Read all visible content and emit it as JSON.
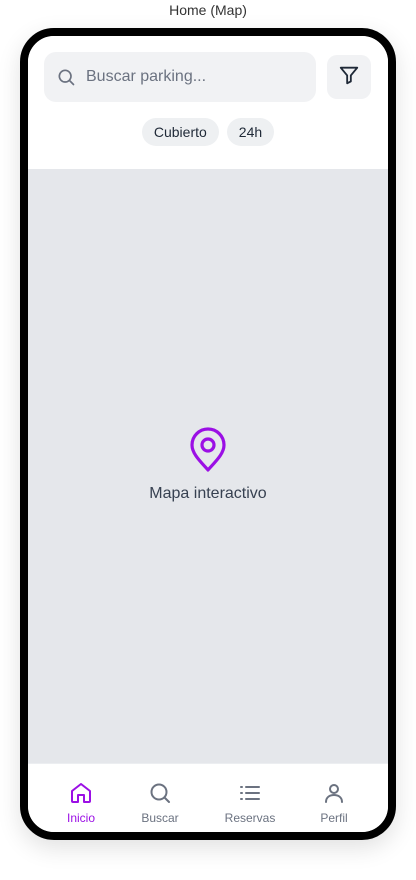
{
  "frame": {
    "title": "Home (Map)"
  },
  "search": {
    "placeholder": "Buscar parking..."
  },
  "filters": {
    "chips": [
      "Cubierto",
      "24h"
    ]
  },
  "map": {
    "label": "Mapa interactivo"
  },
  "nav": {
    "items": [
      {
        "label": "Inicio",
        "icon": "home-icon",
        "active": true
      },
      {
        "label": "Buscar",
        "icon": "search-icon",
        "active": false
      },
      {
        "label": "Reservas",
        "icon": "list-icon",
        "active": false
      },
      {
        "label": "Perfil",
        "icon": "user-icon",
        "active": false
      }
    ]
  },
  "colors": {
    "accent": "#9b0fe5",
    "map_bg": "#e5e7eb",
    "muted": "#6b7280"
  }
}
